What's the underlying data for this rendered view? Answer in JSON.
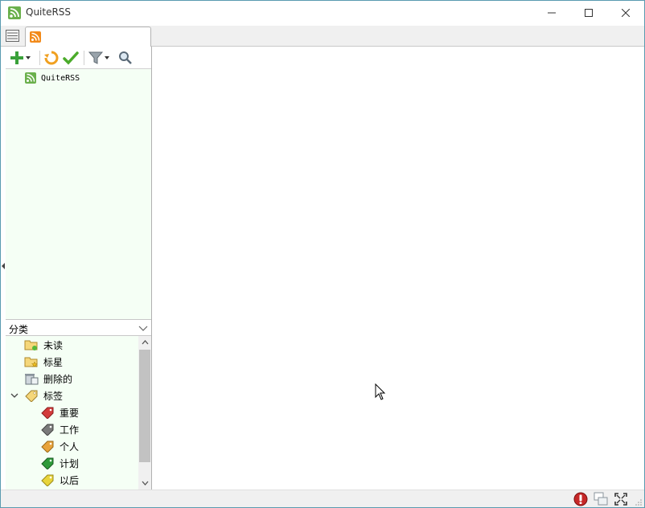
{
  "window": {
    "title": "QuiteRSS"
  },
  "feeds": [
    {
      "label": "QuiteRSS",
      "icon": "rss-feed-icon"
    }
  ],
  "categories": {
    "selector_label": "分类",
    "items": [
      {
        "label": "未读",
        "icon": "unread-folder-icon",
        "level": 0
      },
      {
        "label": "标星",
        "icon": "starred-folder-icon",
        "level": 0
      },
      {
        "label": "删除的",
        "icon": "deleted-icon",
        "level": 0
      },
      {
        "label": "标签",
        "icon": "labels-tag-icon",
        "level": 0,
        "expanded": true
      },
      {
        "label": "重要",
        "icon": "tag-red-icon",
        "level": 1,
        "color": "#d33b3b"
      },
      {
        "label": "工作",
        "icon": "tag-gray-icon",
        "level": 1,
        "color": "#7a7a7a"
      },
      {
        "label": "个人",
        "icon": "tag-orange-icon",
        "level": 1,
        "color": "#e8a33a"
      },
      {
        "label": "计划",
        "icon": "tag-green-icon",
        "level": 1,
        "color": "#2f9a3a"
      },
      {
        "label": "以后",
        "icon": "tag-yellow-icon",
        "level": 1,
        "color": "#e8d43a"
      }
    ]
  },
  "colors": {
    "feed_tree_bg": "#f5fff5",
    "rss_orange": "#f28a1a",
    "rss_green": "#6ab04c",
    "window_border": "#5a9bb0"
  }
}
